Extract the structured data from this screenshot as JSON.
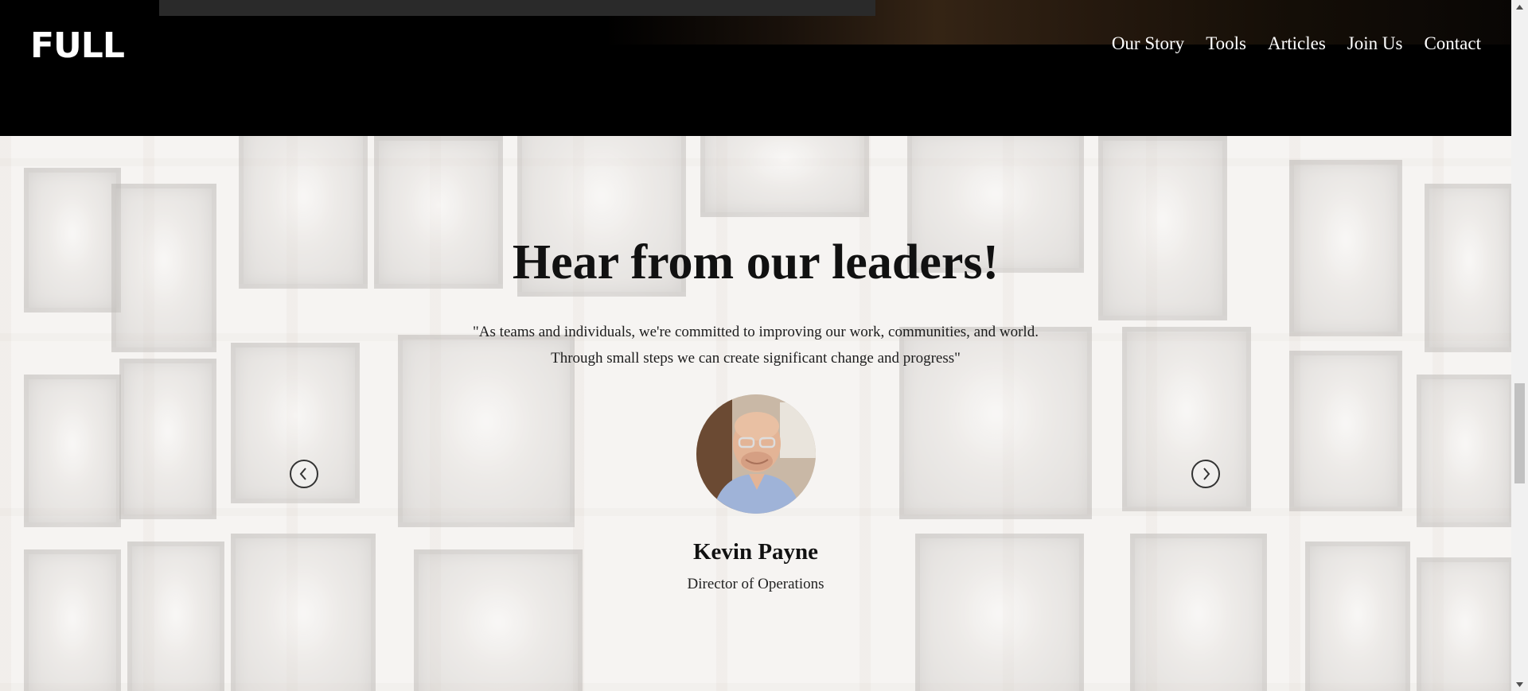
{
  "header": {
    "logo_text": "FULL",
    "nav": [
      {
        "label": "Our Story"
      },
      {
        "label": "Tools"
      },
      {
        "label": "Articles"
      },
      {
        "label": "Join Us"
      },
      {
        "label": "Contact"
      }
    ]
  },
  "leaders": {
    "title": "Hear from our leaders!",
    "quote_line1": "\"As teams and individuals, we're committed to improving our work, communities, and world.",
    "quote_line2": "Through small steps we can create significant change and progress\"",
    "current": {
      "name": "Kevin Payne",
      "role": "Director of Operations"
    }
  },
  "colors": {
    "header_bg": "#000000",
    "text_dark": "#111111",
    "text_light": "#ffffff"
  },
  "icons": {
    "prev": "chevron-left-circle-icon",
    "next": "chevron-right-circle-icon",
    "scroll_up": "triangle-up-icon",
    "scroll_down": "triangle-down-icon"
  }
}
